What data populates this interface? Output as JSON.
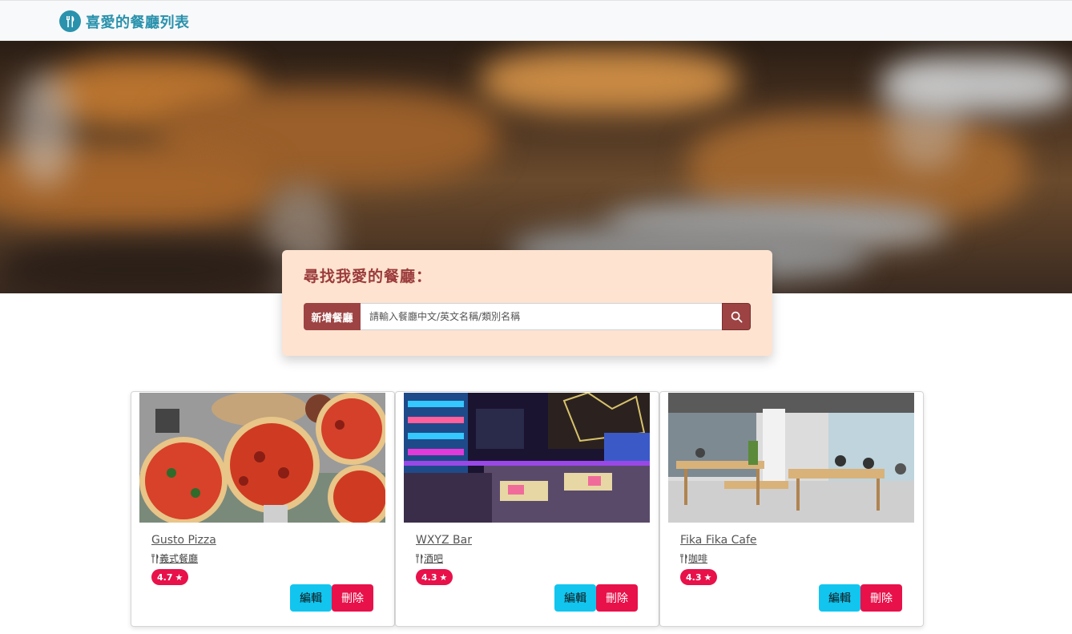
{
  "navbar": {
    "brand_icon": "utensils-icon",
    "brand_title": "喜愛的餐廳列表",
    "brand_color": "#2a92ad"
  },
  "search": {
    "title": "尋找我愛的餐廳：",
    "add_button_label": "新增餐廳",
    "placeholder": "請輸入餐廳中文/英文名稱/類別名稱",
    "search_icon": "magnifier-icon"
  },
  "colors": {
    "accent": "#9d4343",
    "edit": "#11c5ef",
    "delete": "#e8114a",
    "panel": "#fde3d0"
  },
  "restaurants": [
    {
      "name": "Gusto Pizza",
      "category": "義式餐廳",
      "rating": "4.7",
      "edit_label": "編輯",
      "delete_label": "刪除",
      "image": "pizza-photo"
    },
    {
      "name": "WXYZ Bar",
      "category": "酒吧",
      "rating": "4.3",
      "edit_label": "編輯",
      "delete_label": "刪除",
      "image": "bar-photo"
    },
    {
      "name": "Fika Fika Cafe",
      "category": "咖啡",
      "rating": "4.3",
      "edit_label": "編輯",
      "delete_label": "刪除",
      "image": "cafe-photo"
    }
  ]
}
